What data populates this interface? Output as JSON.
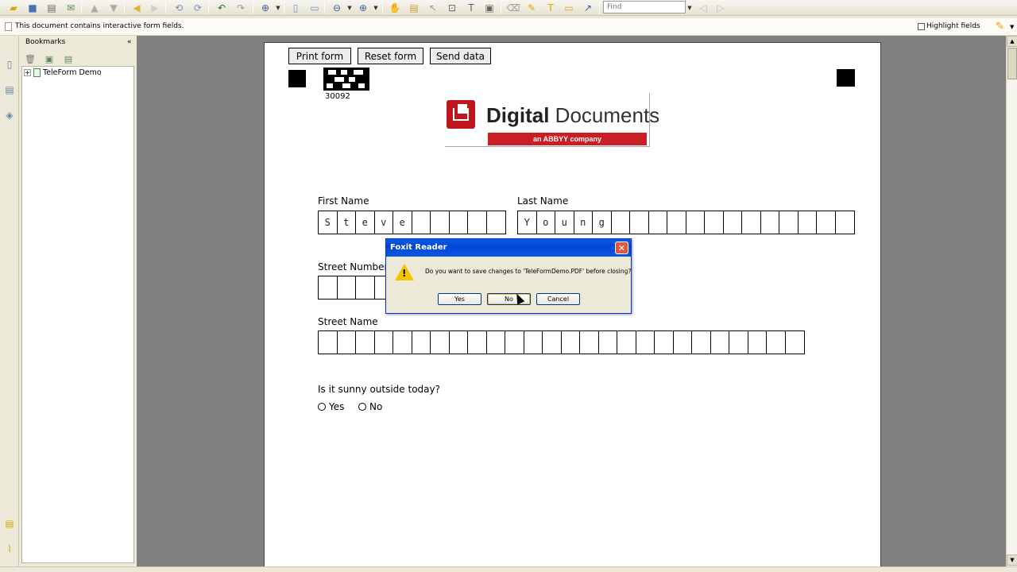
{
  "toolbar": {
    "find_placeholder": "Find",
    "icons": [
      "open-icon",
      "save-icon",
      "print-icon",
      "email-icon",
      "first-page-icon",
      "previous-page-icon",
      "back-icon",
      "forward-icon",
      "rotate-left-icon",
      "rotate-right-icon",
      "undo-icon",
      "redo-icon",
      "zoom-icon",
      "zoom-out-icon",
      "zoom-in-icon",
      "hand-tool-icon",
      "select-text-icon",
      "snapshot-icon",
      "typewriter-icon",
      "comment-icon",
      "pencil-icon",
      "arrow-icon"
    ]
  },
  "message_bar": {
    "text": "This document contains interactive form fields.",
    "highlight_label": "Highlight fields"
  },
  "bookmarks": {
    "title": "Bookmarks",
    "collapse": "«",
    "items": [
      {
        "label": "TeleForm Demo",
        "expand": "+"
      }
    ]
  },
  "form": {
    "print_button": "Print form",
    "reset_button": "Reset form",
    "send_button": "Send data",
    "barcode_number": "30092",
    "logo_bold": "Digital",
    "logo_light": " Documents",
    "logo_sub": "an ABBYY company",
    "first_name_label": "First Name",
    "first_name_chars": [
      "S",
      "t",
      "e",
      "v",
      "e",
      "",
      "",
      "",
      "",
      ""
    ],
    "last_name_label": "Last Name",
    "last_name_chars": [
      "Y",
      "o",
      "u",
      "n",
      "g",
      "",
      "",
      "",
      "",
      "",
      "",
      "",
      "",
      "",
      "",
      "",
      "",
      ""
    ],
    "street_number_label": "Street Number",
    "street_number_chars": [
      "",
      "",
      "",
      ""
    ],
    "street_name_label": "Street Name",
    "street_name_chars": [
      "",
      "",
      "",
      "",
      "",
      "",
      "",
      "",
      "",
      "",
      "",
      "",
      "",
      "",
      "",
      "",
      "",
      "",
      "",
      "",
      "",
      "",
      "",
      "",
      "",
      ""
    ],
    "question": "Is it sunny outside today?",
    "answer_yes": "Yes",
    "answer_no": "No"
  },
  "dialog": {
    "title": "Foxit Reader",
    "message": "Do you want to save changes to 'TeleFormDemo.PDF' before closing?",
    "yes": "Yes",
    "no": "No",
    "cancel": "Cancel",
    "close": "✕"
  }
}
